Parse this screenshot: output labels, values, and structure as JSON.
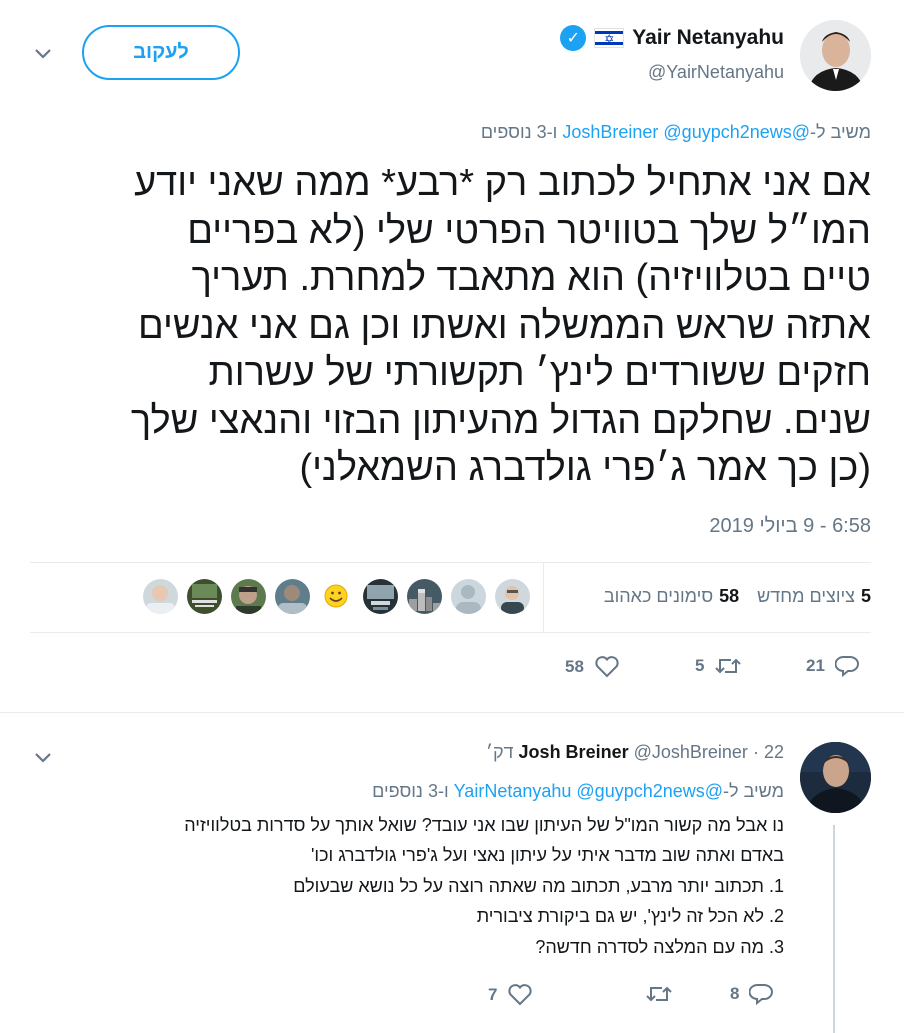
{
  "main_tweet": {
    "author_name": "Yair Netanyahu",
    "author_handle": "@YairNetanyahu",
    "follow_label": "לעקוב",
    "replying_prefix": "משיב ל-",
    "replying_handle_1": "@JoshBreiner",
    "replying_handle_2": "@guypch2news",
    "replying_suffix": "ו-3 נוספים",
    "text_lines": [
      "אם אני אתחיל לכתוב רק *רבע* ממה שאני יודע",
      "המו״ל שלך בטוויטר הפרטי שלי (לא בפריים",
      "טיים בטלוויזיה) הוא מתאבד למחרת. תעריך",
      "אתזה שראש הממשלה ואשתו וכן גם אני אנשים",
      "חזקים ששורדים לינץ׳ תקשורתי של עשרות",
      "שנים. שחלקם הגדול מהעיתון הבזוי והנאצי שלך",
      "(כן כך אמר ג׳פרי גולדברג השמאלני)"
    ],
    "timestamp": "6:58 - 9 ביולי 2019",
    "retweets_count": "5",
    "retweets_label": "ציוצים מחדש",
    "likes_count": "58",
    "likes_label": "סימונים כאהוב",
    "action_replies": "21",
    "action_retweets": "5",
    "action_likes": "58"
  },
  "reply_tweet": {
    "author_name": "Josh Breiner",
    "author_handle": "@JoshBreiner",
    "time_ago": "22 דק׳",
    "replying_prefix": "משיב ל-",
    "replying_handle_1": "@YairNetanyahu",
    "replying_handle_2": "@guypch2news",
    "replying_suffix": "ו-3 נוספים",
    "text_lines": [
      "נו אבל מה קשור המו\"ל של העיתון שבו אני עובד? שואל אותך על סדרות בטלוויזיה",
      "באדם ואתה שוב מדבר איתי על עיתון נאצי ועל ג'פרי גולדברג וכו'",
      "1. תכתוב יותר מרבע, תכתוב מה שאתה רוצה על כל נושא שבעולם",
      "2. לא הכל זה לינץ', יש גם ביקורת ציבורית",
      "3. מה עם המלצה לסדרה חדשה?"
    ],
    "action_replies": "8",
    "action_retweets": "",
    "action_likes": "7"
  },
  "icons": {
    "verified": "verified-badge-icon",
    "flag": "israel-flag-icon",
    "reply": "reply-icon",
    "retweet": "retweet-icon",
    "like": "heart-icon",
    "more": "chevron-down-icon"
  },
  "colors": {
    "accent": "#1da1f2",
    "secondary_text": "#657786",
    "primary_text": "#14171a",
    "divider": "#e6ecf0"
  }
}
